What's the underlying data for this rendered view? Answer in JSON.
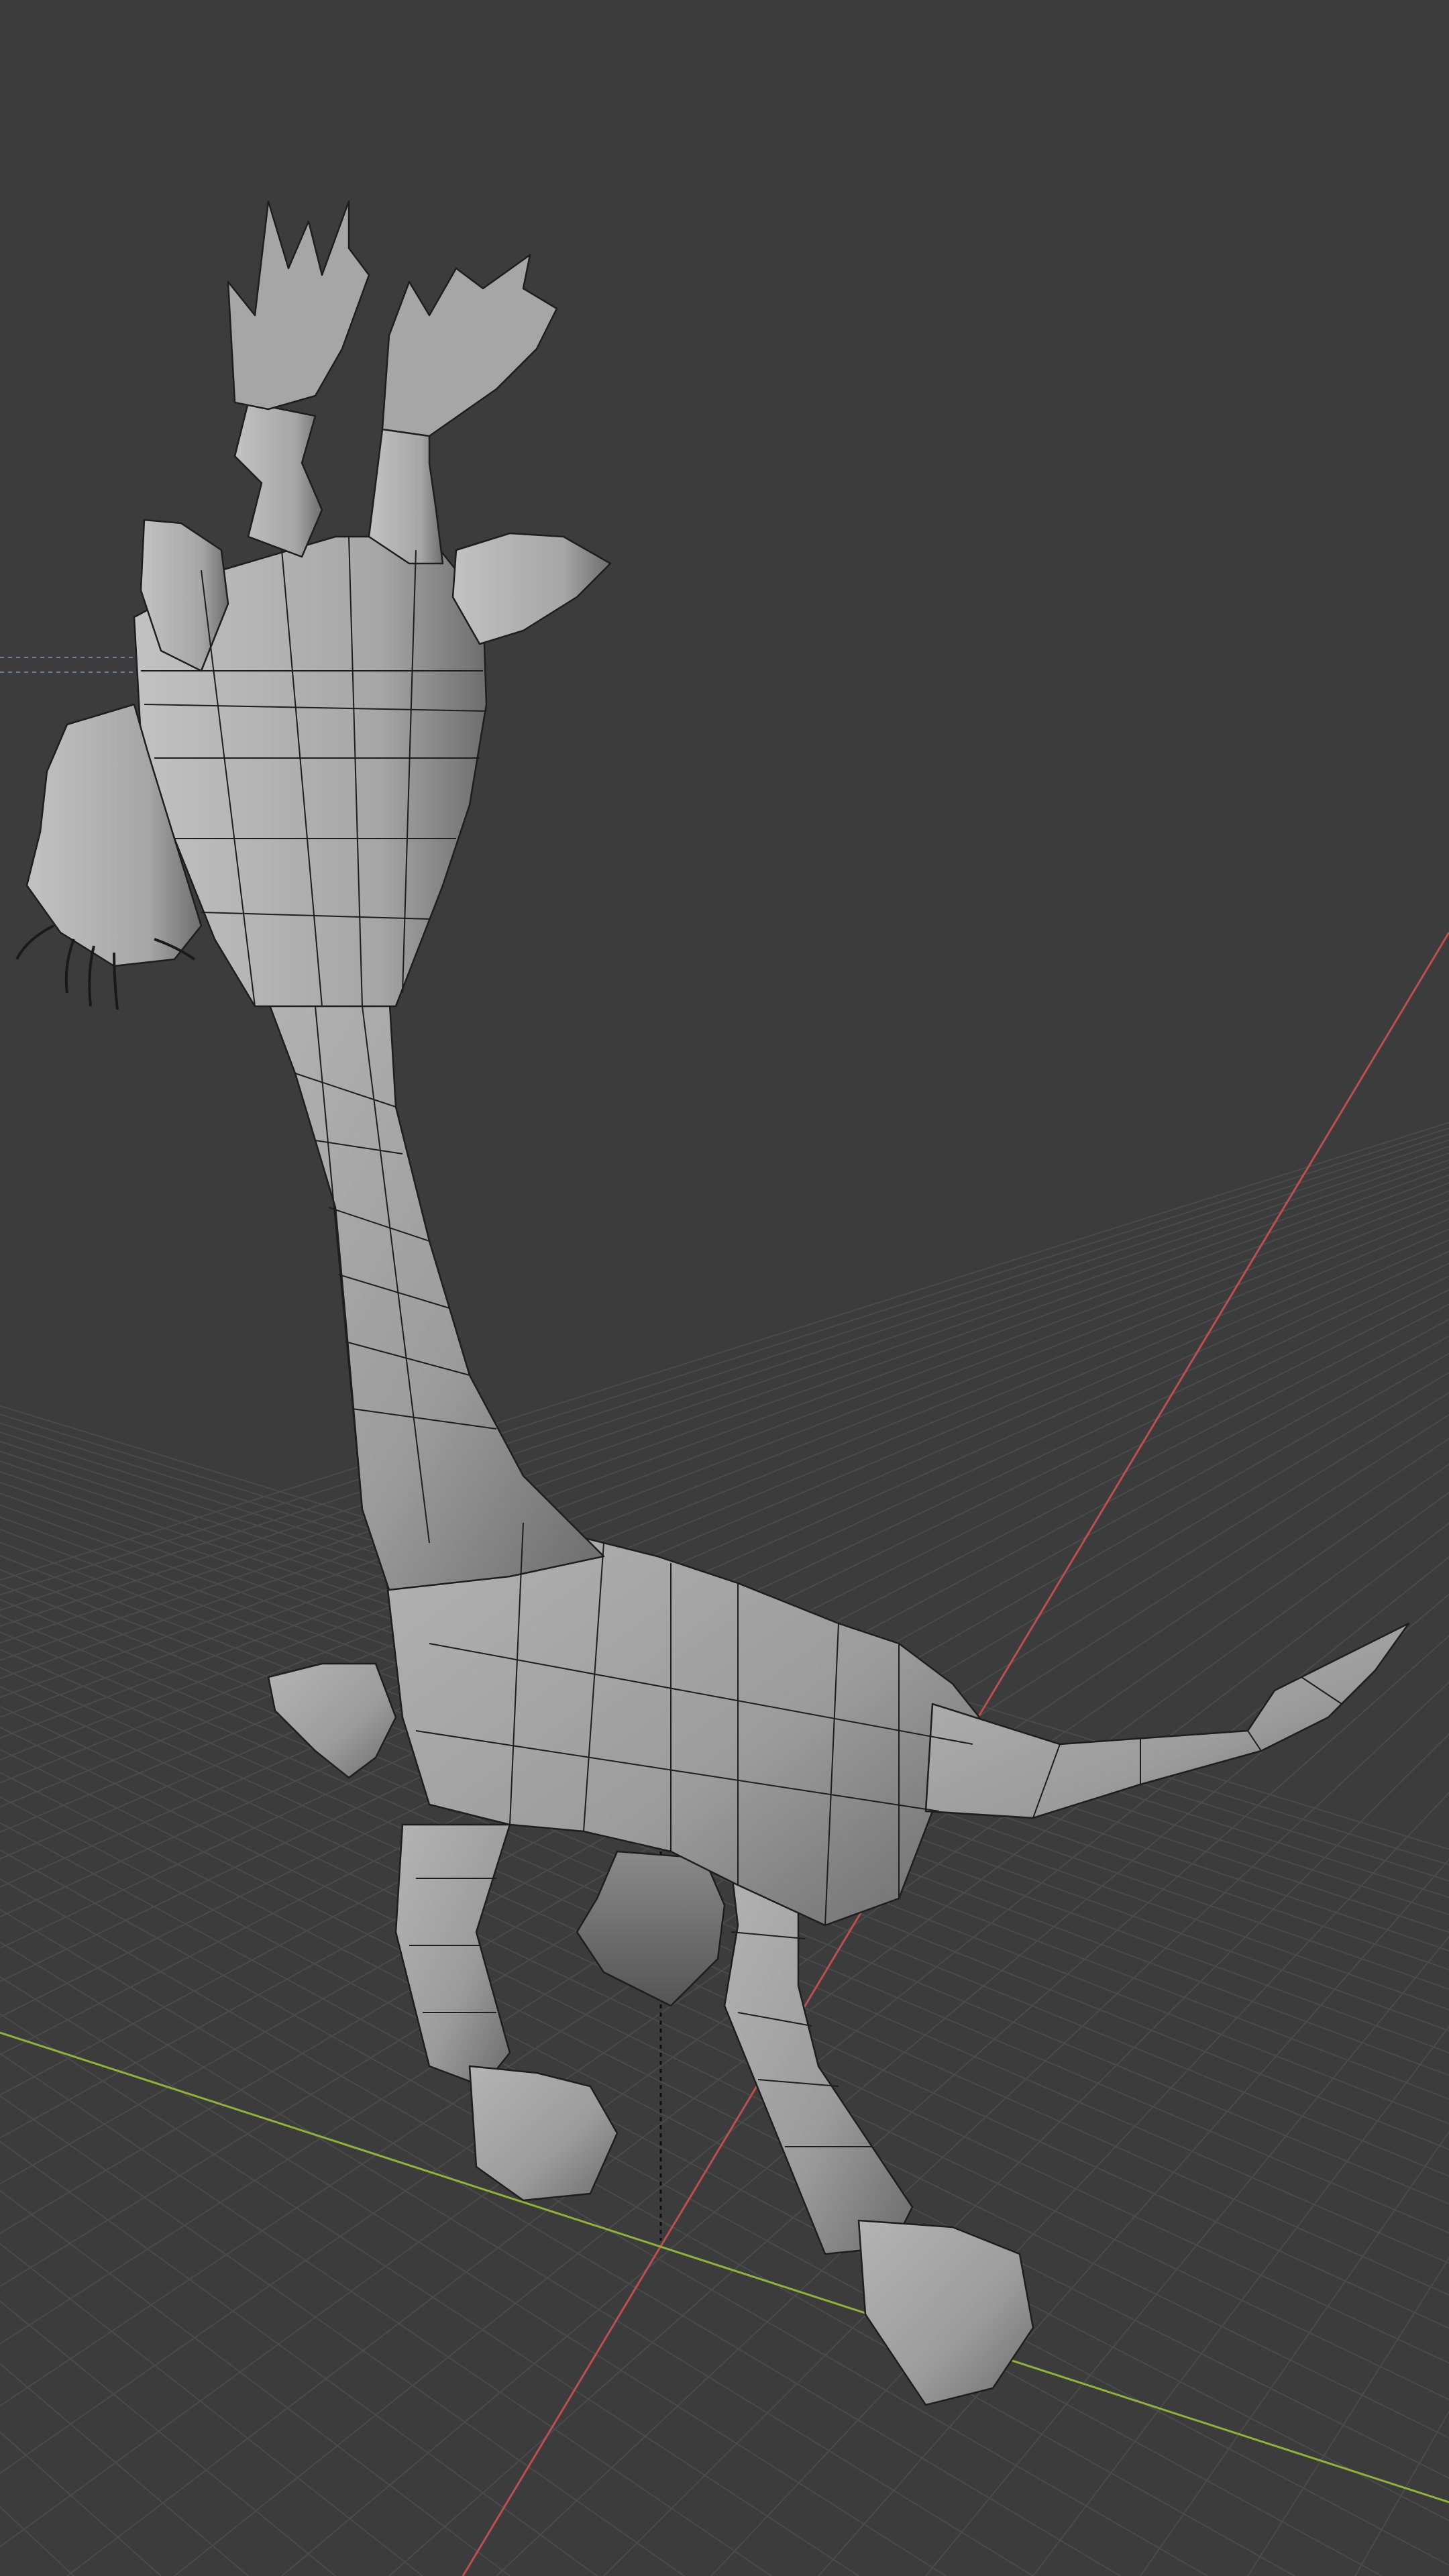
{
  "viewport": {
    "background": "#3c3c3c",
    "grid_color": "#4a4a4a",
    "x_axis_color": "#b9504f",
    "y_axis_color": "#8fb33a",
    "mesh_fill": "#9d9d9d",
    "mesh_wire": "#1e1e1e",
    "shading": "solid",
    "overlays": "wireframe"
  }
}
